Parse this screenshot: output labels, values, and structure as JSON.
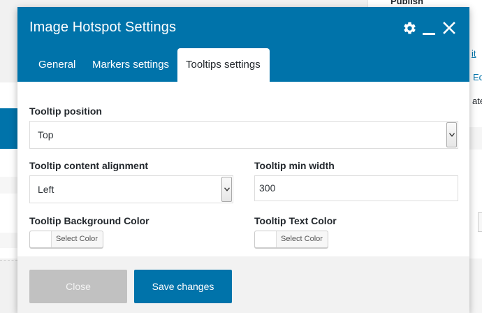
{
  "background": {
    "publish_label": "Publish",
    "link_edit": "it",
    "link_ed": "Ed",
    "text_ate": "ate"
  },
  "modal": {
    "title": "Image Hotspot Settings",
    "tabs": [
      {
        "label": "General",
        "active": false
      },
      {
        "label": "Markers settings",
        "active": false
      },
      {
        "label": "Tooltips settings",
        "active": true
      }
    ],
    "fields": {
      "tooltip_position": {
        "label": "Tooltip position",
        "value": "Top"
      },
      "content_alignment": {
        "label": "Tooltip content alignment",
        "value": "Left"
      },
      "min_width": {
        "label": "Tooltip min width",
        "value": "300"
      },
      "bg_color": {
        "label": "Tooltip Background Color",
        "button_label": "Select Color"
      },
      "text_color": {
        "label": "Tooltip Text Color",
        "button_label": "Select Color"
      }
    },
    "footer": {
      "close_label": "Close",
      "save_label": "Save changes"
    }
  },
  "colors": {
    "accent": "#0073aa",
    "close_button": "#c1c1c1",
    "footer_bg": "#f2f2f2"
  },
  "icons": {
    "settings": "gear-icon",
    "minimize": "minimize-icon",
    "close": "close-icon"
  }
}
